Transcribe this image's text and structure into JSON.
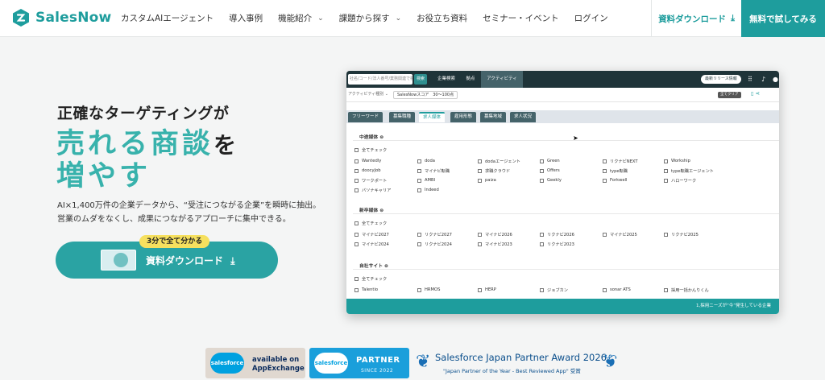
{
  "header": {
    "logo_text": "SalesNow",
    "nav": [
      {
        "label": "カスタムAIエージェント",
        "dropdown": false
      },
      {
        "label": "導入事例",
        "dropdown": false
      },
      {
        "label": "機能紹介",
        "dropdown": true
      },
      {
        "label": "課題から探す",
        "dropdown": true
      },
      {
        "label": "お役立ち資料",
        "dropdown": false
      },
      {
        "label": "セミナー・イベント",
        "dropdown": false
      },
      {
        "label": "ログイン",
        "dropdown": false
      }
    ],
    "download_label": "資料ダウンロード",
    "trial_label": "無料で試してみる",
    "download_glyph": "⤓"
  },
  "hero": {
    "lead": "正確なターゲティングが",
    "big1": "売れる商談",
    "big1_suffix": "を",
    "big2": "増やす",
    "desc1": "AI×1,400万件の企業データから、“受注につながる企業”を瞬時に抽出。",
    "desc2": "営業のムダをなくし、成果につながるアプローチに集中できる。",
    "cta_badge": "3分で全て分かる",
    "cta_label": "資料ダウンロード",
    "cta_glyph": "⤓"
  },
  "app": {
    "search_placeholder": "社名/コード/法人番号/業務関連で検索",
    "search_button": "検索",
    "tabs": [
      "企業検索",
      "拠点",
      "アクティビティ"
    ],
    "news_label": "最新リリース情報",
    "filter_select": "アクティビティ種別",
    "filter_chip": "SalesNowスコア　30〜100点",
    "clear_label": "全てクリア",
    "tabs2": [
      "フリーワード",
      "募集職種",
      "求人媒体",
      "雇用形態",
      "募集地域",
      "求人状況"
    ],
    "tabs2_active": 2,
    "sections": [
      {
        "title": "中途媒体 ⊜",
        "select_all": "全てチェック",
        "rows": [
          [
            "Wantedly",
            "doda",
            "dodaエージェント",
            "Green",
            "リクナビNEXT",
            "Workship"
          ],
          [
            "doocyJob",
            "マイナビ転職",
            "求職クラウド",
            "Offers",
            "type転職",
            "type転職エージェント"
          ],
          [
            "ワークポート",
            "AMBI",
            "paiza",
            "Geekly",
            "Forkwell",
            "ハローワーク"
          ],
          [
            "バソナキャリア",
            "Indeed"
          ]
        ]
      },
      {
        "title": "新卒媒体 ⊜",
        "select_all": "全てチェック",
        "rows": [
          [
            "マイナビ2027",
            "リクナビ2027",
            "マイナビ2026",
            "リクナビ2026",
            "マイナビ2025",
            "リクナビ2025"
          ],
          [
            "マイナビ2024",
            "リクナビ2024",
            "マイナビ2023",
            "リクナビ2023"
          ]
        ]
      },
      {
        "title": "自社サイト ⊜",
        "select_all": "全てチェック",
        "rows": [
          [
            "Talentio",
            "HRMOS",
            "HERP",
            "ジョブカン",
            "sonar ATS",
            "採用一括かんりくん"
          ]
        ]
      }
    ],
    "footer_text": "1,採用ニーズが“今”発生している企業"
  },
  "badges": {
    "cloud_text": "salesforce",
    "appexchange_1": "available on",
    "appexchange_2": "AppExchange",
    "partner_1": "PARTNER",
    "partner_2": "SINCE 2022",
    "award_1": "Salesforce Japan Partner Award 2026",
    "award_2": "\"Japan Partner of the Year - Best Reviewed App\" 受賞"
  }
}
